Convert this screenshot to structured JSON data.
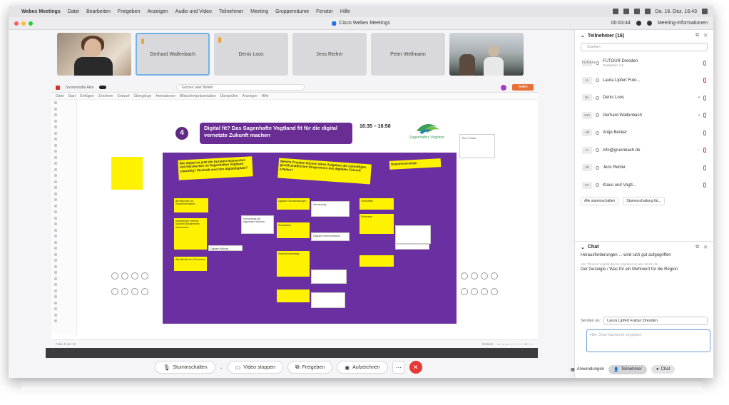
{
  "menubar": {
    "app": "Webex Meetings",
    "items": [
      "Datei",
      "Bearbeiten",
      "Freigeben",
      "Anzeigen",
      "Audio und Video",
      "Teilnehmer",
      "Meeting",
      "Gruppenräume",
      "Fenster",
      "Hilfe"
    ],
    "clock": "Do. 16. Dez. 16:43"
  },
  "window": {
    "title": "Cisco Webex Meetings",
    "time": "00:43:44",
    "info": "Meeting-Informationen"
  },
  "videos": [
    {
      "name": ""
    },
    {
      "name": "Gerhard Wallenbach"
    },
    {
      "name": "Denis Loos"
    },
    {
      "name": "Jens Reiher"
    },
    {
      "name": "Peter Wellmann"
    },
    {
      "name": ""
    }
  ],
  "share": {
    "topbar": "Sonnenhafte Akte",
    "search": "Suchen oder Befehl",
    "button": "Teilen",
    "menu": [
      "Datei",
      "Start",
      "Einfügen",
      "Zeichnen",
      "Entwurf",
      "Übergänge",
      "Animationen",
      "Bildschirmpräsentation",
      "Überprüfen",
      "Anzeigen",
      "Hilfe"
    ],
    "slide_number": "4",
    "heading": "Digital fit? Das Sagenhafte Vogtland fit für die digital vernetzte Zukunft machen",
    "time": "16:35 – 16:58",
    "logo": "Sagenhaftes Vogtland",
    "side_note": "Tool / Team",
    "footer_left": "Folie 4 von 12",
    "footer_right": "Notizen"
  },
  "stickies": {
    "big1": "Wie digital ist jetzt die Sozialen Netzwerken und Netzwerken im Sagenhaften Vogtland zukünftig? Weshalb sind den digitaldigitale?",
    "big2": "Welche Projekte können diese Aufgaben die zukünftigen gesellschaftlichen Bürgerinnen des digitalen Zukunft erfüllen?",
    "big3": "Daseinsvorsorge",
    "s1": "Bereitschaft zur Zusammenarbeit",
    "s2": "Infrastruktur Internet Schulen Bürgerinnen Kommunen",
    "s3": "Digitale Bildung",
    "s4": "Attraktivität des Tourismus",
    "s5": "Vernetzung der regionalen Akteure",
    "s6": "Digitale Dienstleistungen",
    "s7": "Vernetzung",
    "s8": "Sozialraum",
    "s9": "Digitale Kommunikation",
    "s10": "Standortmarketing",
    "s11": "Fachkräfte",
    "s12": "Ehrenamt"
  },
  "controls": {
    "mute": "Stummschalten",
    "video": "Video stoppen",
    "share": "Freigeben",
    "record": "Aufzeichnen"
  },
  "panel": {
    "participants_title": "Teilnehmer (16)",
    "search": "Suchen",
    "participants": [
      {
        "initials": "FUTOUR",
        "name": "FUTOUR Dresden",
        "sub": "Gastgeber, Ich"
      },
      {
        "initials": "LL",
        "name": "Laura Lipfert Futo..."
      },
      {
        "initials": "DL",
        "name": "Denis Loos"
      },
      {
        "initials": "GW",
        "name": "Gerhard Wallenbach"
      },
      {
        "initials": "AB",
        "name": "Antje Becker"
      },
      {
        "initials": "In",
        "name": "info@gruenbach.de"
      },
      {
        "initials": "JR",
        "name": "Jens Reiher"
      },
      {
        "initials": "KV",
        "name": "Klaus und Vogtl..."
      }
    ],
    "mute_all": "Alle stummschalten",
    "unmute_all": "Stummschaltung für...",
    "chat_title": "Chat",
    "messages": [
      {
        "meta": "",
        "body": "Herausforderungen ... wird sich gut aufgegriffen"
      },
      {
        "meta": "Von Thomas Vogtlandische Vogtland an alle   16:46 Uhr",
        "body": "Der Gezeigte / Was für ein Mehrwert für die Region"
      }
    ],
    "send_to_label": "Senden an:",
    "send_to": "Laura Lipfert Futour Dresden",
    "input_placeholder": "Hier Chat-Nachricht eingeben",
    "footer": {
      "apps": "Anwendungen",
      "participants": "Teilnehmer",
      "chat": "Chat"
    }
  }
}
